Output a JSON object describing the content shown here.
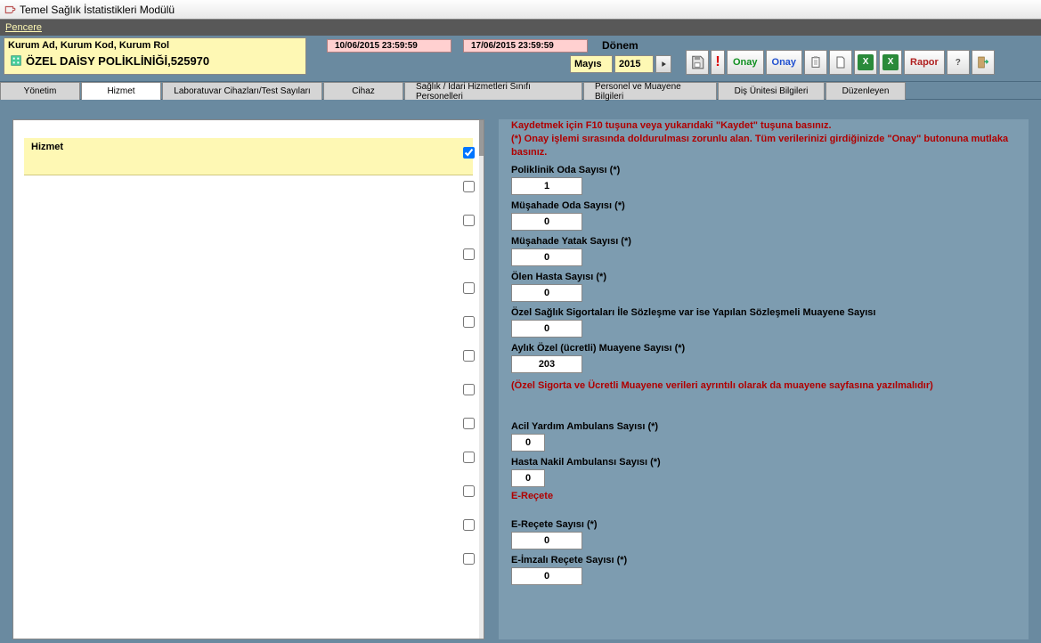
{
  "window": {
    "title": "Temel Sağlık İstatistikleri Modülü"
  },
  "menubar": {
    "window": "Pencere"
  },
  "top": {
    "kurum_header": "Kurum Ad, Kurum Kod, Kurum Rol",
    "kurum_value": "ÖZEL DAİSY POLİKLİNİĞİ,525970",
    "date1": "10/06/2015 23:59:59",
    "date2": "17/06/2015 23:59:59",
    "donem_label": "Dönem",
    "donem_month": "Mayıs",
    "donem_year": "2015"
  },
  "toolbar": {
    "onay": "Onay",
    "onay2": "Onay",
    "rapor": "Rapor"
  },
  "tabs": {
    "yonetim": "Yönetim",
    "hizmet": "Hizmet",
    "lab": "Laboratuvar Cihazları/Test Sayıları",
    "cihaz": "Cihaz",
    "sinif": "Sağlık / İdari Hizmetleri Sınıfı Personelleri",
    "personel": "Personel ve Muayene Bilgileri",
    "dis": "Diş Ünitesi Bilgileri",
    "duz": "Düzenleyen"
  },
  "left": {
    "header": "Hizmet"
  },
  "right": {
    "warn1": "Kaydetmek için F10 tuşuna veya yukarıdaki \"Kaydet\" tuşuna basınız.",
    "warn2": "(*) Onay işlemi sırasında doldurulması zorunlu alan. Tüm verilerinizi girdiğinizde \"Onay\" butonuna mutlaka basınız.",
    "f_poliklinik": "Poliklinik Oda Sayısı (*)",
    "v_poliklinik": "1",
    "f_musahade_oda": "Müşahade Oda  Sayısı (*)",
    "v_musahade_oda": "0",
    "f_musahade_yatak": "Müşahade Yatak Sayısı (*)",
    "v_musahade_yatak": "0",
    "f_olen": "Ölen Hasta Sayısı (*)",
    "v_olen": "0",
    "f_ozel": "Özel Sağlık Sigortaları İle Sözleşme var ise Yapılan Sözleşmeli Muayene Sayısı",
    "v_ozel": "0",
    "f_aylik": "Aylık Özel (ücretli) Muayene Sayısı (*)",
    "v_aylik": "203",
    "note1": "(Özel Sigorta ve Ücretli Muayene verileri ayrıntılı olarak da  muayene sayfasına yazılmalıdır)",
    "f_acil": "Acil Yardım Ambulans Sayısı (*)",
    "v_acil": "0",
    "f_nakil": "Hasta Nakil Ambulansı Sayısı (*)",
    "v_nakil": "0",
    "erecete_head": "E-Reçete",
    "f_erecete": "E-Reçete Sayısı (*)",
    "v_erecete": "0",
    "f_eimzali": "E-İmzalı Reçete Sayısı (*)",
    "v_eimzali": "0"
  }
}
